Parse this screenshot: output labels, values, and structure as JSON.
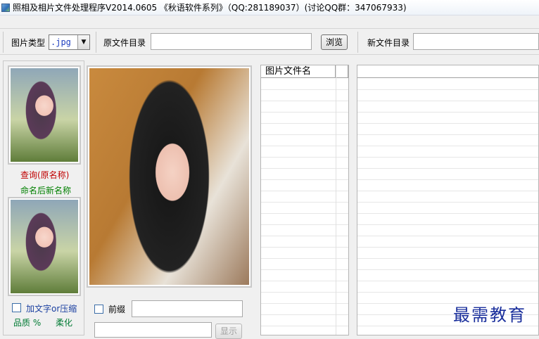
{
  "window": {
    "title": "照相及相片文件处理程序V2014.0605 《秋语软件系列》（QQ:281189037）(讨论QQ群：347067933)"
  },
  "toolbar": {
    "image_type_label": "图片类型",
    "image_type_value": ".jpg",
    "source_dir_label": "原文件目录",
    "source_dir_value": "",
    "browse_label": "浏览",
    "new_dir_label": "新文件目录",
    "new_dir_value": ""
  },
  "left_panel": {
    "query_label": "查询(原名称)",
    "rename_label": "命名后新名称",
    "add_text_label": "加文字or压缩",
    "quality_label": "品质 %",
    "soften_label": "柔化"
  },
  "middle_panel": {
    "prefix_label": "前缀",
    "prefix_value": "",
    "display_value": "",
    "display_button_label": "显示"
  },
  "file_list": {
    "column_header": "图片文件名"
  },
  "watermark": "最需教育"
}
